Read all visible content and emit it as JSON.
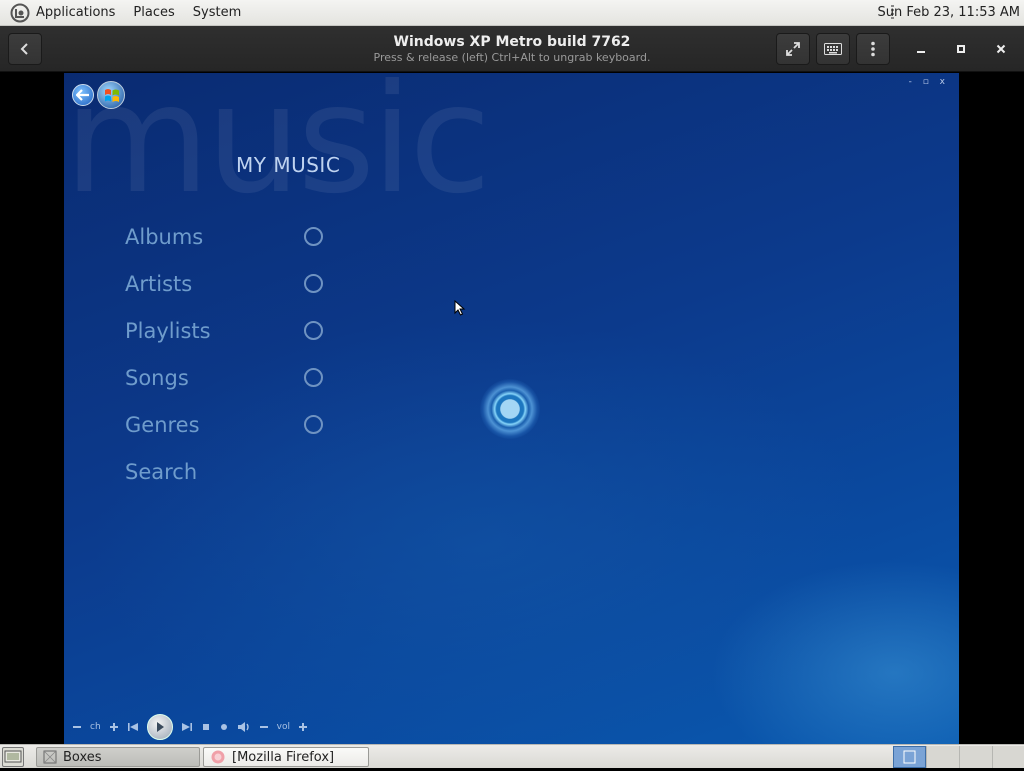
{
  "top_panel": {
    "menus": [
      "Applications",
      "Places",
      "System"
    ],
    "clock": "Sun Feb 23, 11:53 AM"
  },
  "headerbar": {
    "title": "Windows XP Metro build 7762",
    "subtitle": "Press & release (left) Ctrl+Alt to ungrab keyboard."
  },
  "vm": {
    "watermark": "music",
    "page_title": "MY MUSIC",
    "window_controls": "- ▫ x",
    "nav_items": [
      {
        "label": "Albums"
      },
      {
        "label": "Artists"
      },
      {
        "label": "Playlists"
      },
      {
        "label": "Songs"
      },
      {
        "label": "Genres"
      },
      {
        "label": "Search"
      }
    ],
    "transport": {
      "ch_label": "ch",
      "vol_label": "vol"
    }
  },
  "taskbar": {
    "tasks": [
      {
        "label": "Boxes"
      },
      {
        "label": "[Mozilla Firefox]"
      }
    ]
  },
  "colors": {
    "vm_background": "#0c3a8c",
    "nav_text": "#6f9ccc",
    "workspace_active": "#7aa3d6"
  }
}
